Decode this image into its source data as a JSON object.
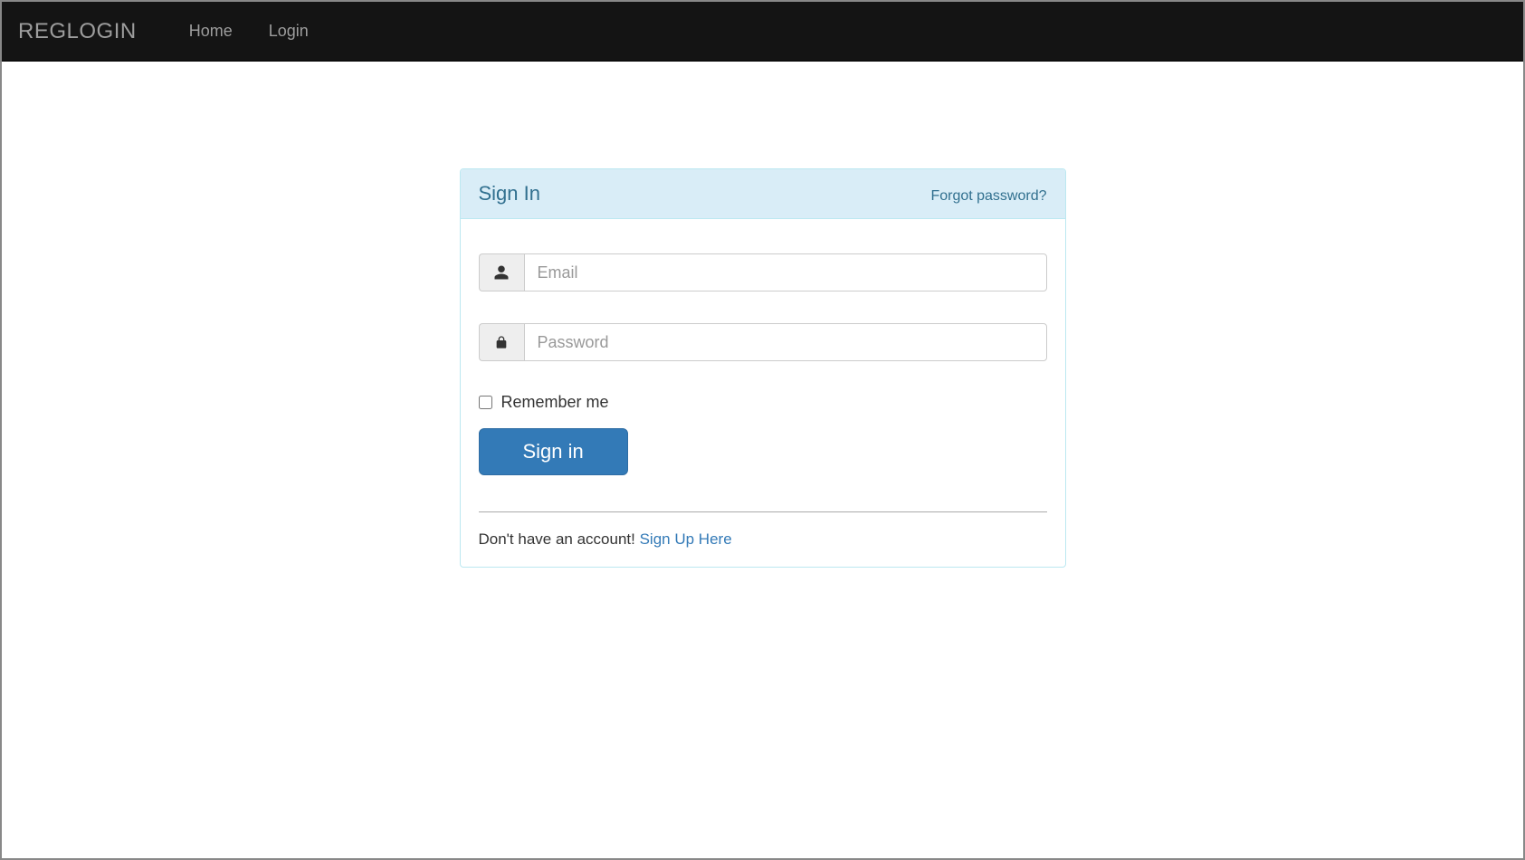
{
  "navbar": {
    "brand": "REGLOGIN",
    "links": {
      "home": "Home",
      "login": "Login"
    }
  },
  "panel": {
    "title": "Sign In",
    "forgot_link": "Forgot password?"
  },
  "form": {
    "email_placeholder": "Email",
    "password_placeholder": "Password",
    "remember_label": "Remember me",
    "submit_label": "Sign in"
  },
  "footer": {
    "signup_prompt": "Don't have an account! ",
    "signup_link": "Sign Up Here"
  }
}
